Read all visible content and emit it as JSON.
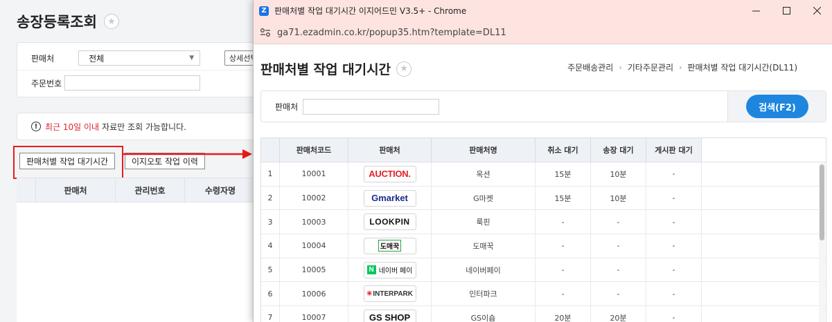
{
  "background": {
    "page_title": "송장등록조회",
    "search": {
      "seller_label": "판매처",
      "seller_value": "전체",
      "detail_button": "상세선택",
      "order_label": "주문번호"
    },
    "notice": {
      "highlight": "최근 10일 이내",
      "rest": "자료만 조회 가능합니다."
    },
    "buttons": {
      "wait_time": "판매처별 작업 대기시간",
      "auto_history": "이지오토 작업 이력"
    },
    "table_headers": [
      "판매처",
      "관리번호",
      "수령자명"
    ]
  },
  "popup": {
    "window_title": "판매처별 작업 대기시간 이지어드민 V3.5+ - Chrome",
    "app_icon": "Z",
    "url": "ga71.ezadmin.co.kr/popup35.htm?template=DL11",
    "page_title": "판매처별 작업 대기시간",
    "breadcrumb": [
      "주문배송관리",
      "기타주문관리",
      "판매처별 작업 대기시간(DL11)"
    ],
    "search_label": "판매처",
    "search_button": "검색(F2)",
    "columns": [
      "판매처코드",
      "판매처",
      "판매처명",
      "취소 대기",
      "송장 대기",
      "게시판 대기"
    ],
    "rows": [
      {
        "no": "1",
        "code": "10001",
        "logo": "AUCTION.",
        "name": "옥션",
        "cancel": "15분",
        "ship": "10분",
        "board": "-"
      },
      {
        "no": "2",
        "code": "10002",
        "logo": "Gmarket",
        "name": "G마켓",
        "cancel": "15분",
        "ship": "10분",
        "board": "-"
      },
      {
        "no": "3",
        "code": "10003",
        "logo": "LOOKPIN",
        "name": "룩핀",
        "cancel": "-",
        "ship": "-",
        "board": "-"
      },
      {
        "no": "4",
        "code": "10004",
        "logo": "도매꾹",
        "name": "도매꾹",
        "cancel": "-",
        "ship": "-",
        "board": "-"
      },
      {
        "no": "5",
        "code": "10005",
        "logo": "네이버 페이",
        "name": "네이버페이",
        "cancel": "-",
        "ship": "-",
        "board": "-"
      },
      {
        "no": "6",
        "code": "10006",
        "logo": "INTERPARK",
        "name": "인터파크",
        "cancel": "-",
        "ship": "-",
        "board": "-"
      },
      {
        "no": "7",
        "code": "10007",
        "logo": "GS SHOP",
        "name": "GS이숍",
        "cancel": "20분",
        "ship": "20분",
        "board": "-"
      }
    ]
  },
  "colors": {
    "accent_blue": "#1f86e0",
    "highlight_red": "#e81b1b",
    "titlebar": "#fde4e1"
  }
}
